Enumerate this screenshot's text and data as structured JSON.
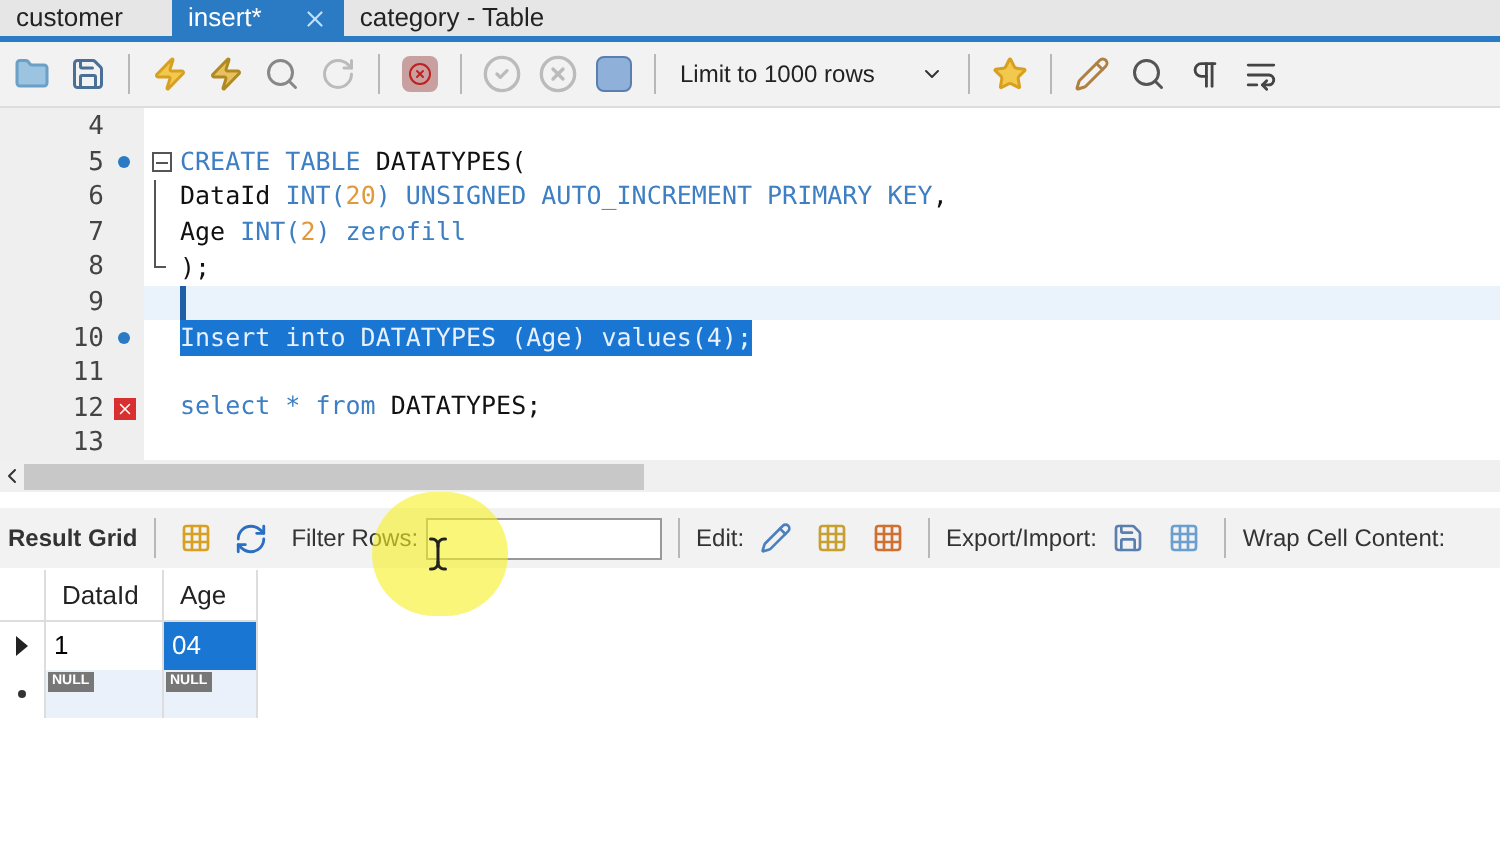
{
  "tabs": [
    {
      "label": "customer",
      "selected": false
    },
    {
      "label": "insert*",
      "selected": true
    },
    {
      "label": "category - Table",
      "selected": false
    }
  ],
  "toolbar": {
    "limit_select": "Limit to 1000 rows"
  },
  "editor": {
    "lines": [
      {
        "number": "4",
        "statement_dot": false,
        "error": false,
        "fold_start": false,
        "fold_body": false,
        "fold_end": false,
        "current": false,
        "selected": false
      },
      {
        "number": "5",
        "statement_dot": true,
        "error": false,
        "fold_start": true,
        "fold_body": false,
        "fold_end": false,
        "current": false,
        "selected": false,
        "tokens": [
          {
            "kind": "keyword",
            "text": "CREATE TABLE "
          },
          {
            "kind": "plain",
            "text": "DATATYPES("
          }
        ]
      },
      {
        "number": "6",
        "statement_dot": false,
        "error": false,
        "fold_start": false,
        "fold_body": true,
        "fold_end": false,
        "current": false,
        "selected": false,
        "tokens": [
          {
            "kind": "plain",
            "text": "DataId "
          },
          {
            "kind": "keyword",
            "text": "INT("
          },
          {
            "kind": "number",
            "text": "20"
          },
          {
            "kind": "keyword",
            "text": ") UNSIGNED AUTO_INCREMENT PRIMARY KEY"
          },
          {
            "kind": "plain",
            "text": ","
          }
        ]
      },
      {
        "number": "7",
        "statement_dot": false,
        "error": false,
        "fold_start": false,
        "fold_body": true,
        "fold_end": false,
        "current": false,
        "selected": false,
        "tokens": [
          {
            "kind": "plain",
            "text": "Age "
          },
          {
            "kind": "keyword",
            "text": "INT("
          },
          {
            "kind": "number",
            "text": "2"
          },
          {
            "kind": "keyword",
            "text": ") zerofill"
          }
        ]
      },
      {
        "number": "8",
        "statement_dot": false,
        "error": false,
        "fold_start": false,
        "fold_body": false,
        "fold_end": true,
        "current": false,
        "selected": false,
        "tokens": [
          {
            "kind": "plain",
            "text": ");"
          }
        ]
      },
      {
        "number": "9",
        "statement_dot": false,
        "error": false,
        "fold_start": false,
        "fold_body": false,
        "fold_end": false,
        "current": true,
        "selected": false
      },
      {
        "number": "10",
        "statement_dot": true,
        "error": false,
        "fold_start": false,
        "fold_body": false,
        "fold_end": false,
        "current": false,
        "selected": true,
        "tokens": [
          {
            "kind": "plain",
            "text": "Insert into DATATYPES (Age) values(4);"
          }
        ]
      },
      {
        "number": "11",
        "statement_dot": false,
        "error": false,
        "fold_start": false,
        "fold_body": false,
        "fold_end": false,
        "current": false,
        "selected": false
      },
      {
        "number": "12",
        "statement_dot": false,
        "error": true,
        "fold_start": false,
        "fold_body": false,
        "fold_end": false,
        "current": false,
        "selected": false,
        "tokens": [
          {
            "kind": "keyword",
            "text": "select * from "
          },
          {
            "kind": "plain",
            "text": "DATATYPES;"
          }
        ]
      },
      {
        "number": "13",
        "statement_dot": false,
        "error": false,
        "fold_start": false,
        "fold_body": false,
        "fold_end": false,
        "current": false,
        "selected": false
      }
    ]
  },
  "result_toolbar": {
    "result_grid": "Result Grid",
    "filter_label": "Filter Rows:",
    "edit_label": "Edit:",
    "export_label": "Export/Import:",
    "wrap_label": "Wrap Cell Content:"
  },
  "grid": {
    "columns": [
      "DataId",
      "Age"
    ],
    "rows": [
      {
        "kind": "current",
        "cells": [
          {
            "text": "1",
            "null": false,
            "selected": false
          },
          {
            "text": "04",
            "null": false,
            "selected": true
          }
        ]
      },
      {
        "kind": "new",
        "cells": [
          {
            "text": "NULL",
            "null": true,
            "selected": false
          },
          {
            "text": "NULL",
            "null": true,
            "selected": false
          }
        ]
      }
    ]
  }
}
